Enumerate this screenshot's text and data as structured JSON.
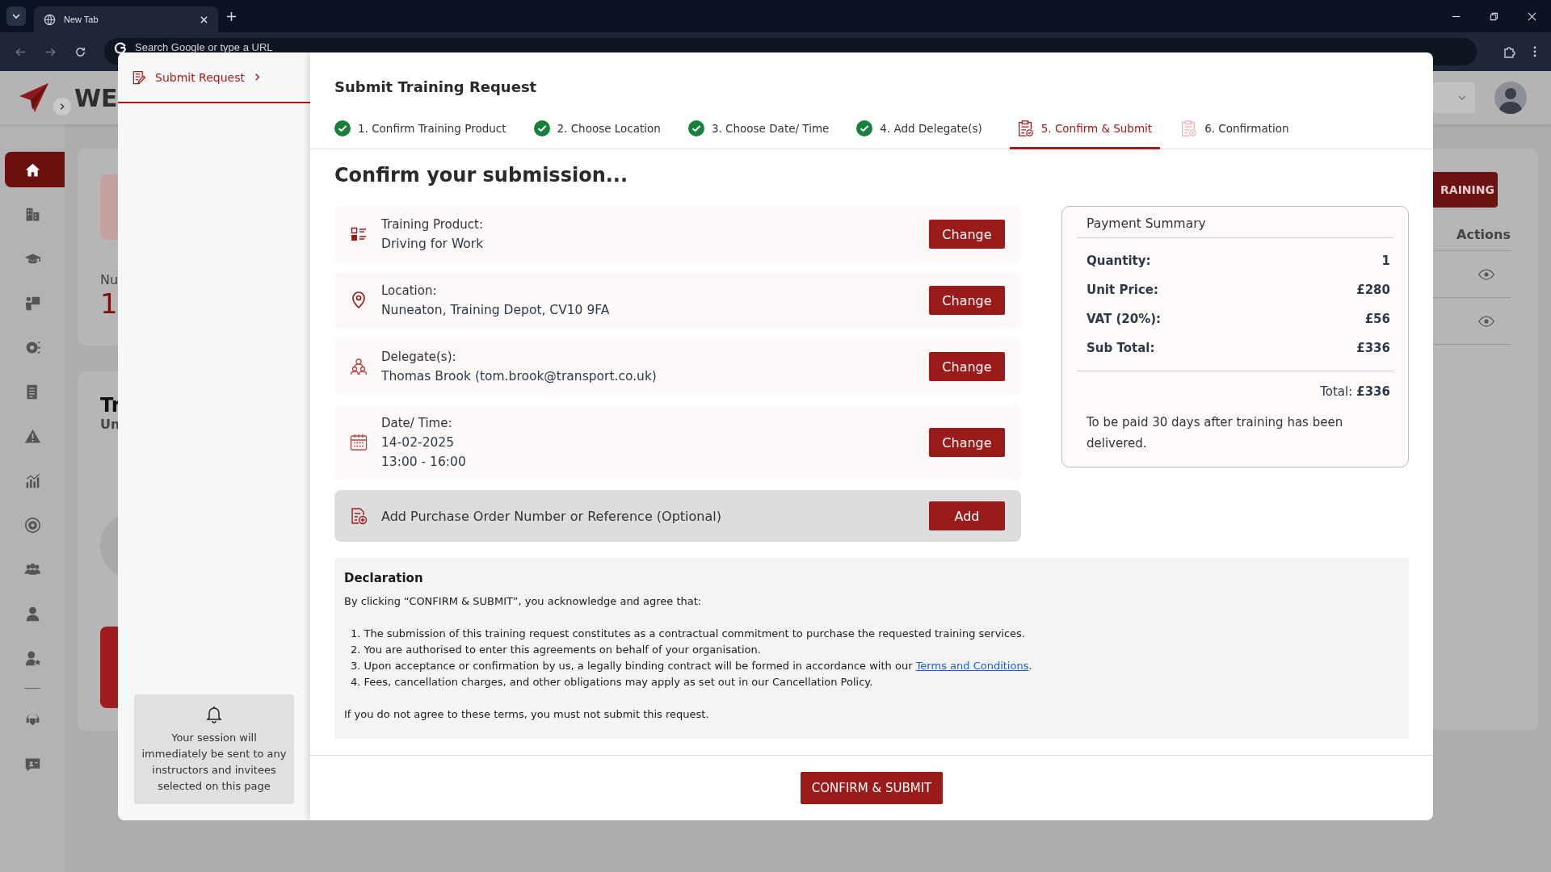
{
  "browser": {
    "tab_title": "New Tab",
    "address_placeholder": "Search Google or type a URL"
  },
  "app": {
    "logo_text": "WE",
    "nav": [
      {
        "selected": true
      },
      {
        "selected": false
      },
      {
        "selected": false
      },
      {
        "selected": false
      },
      {
        "selected": false
      },
      {
        "selected": false
      },
      {
        "selected": false
      },
      {
        "selected": false
      },
      {
        "selected": false
      },
      {
        "selected": false
      },
      {
        "selected": false
      },
      {
        "selected": false
      },
      {
        "selected": false
      },
      {
        "selected": false
      }
    ],
    "stat_label": "Nu",
    "stat_value": "1",
    "section_title": "Tr",
    "section_subtitle": "Un",
    "action_button": "RAINING",
    "table": {
      "columns": [
        "Actions"
      ]
    }
  },
  "modal": {
    "side_tab": {
      "label": "Submit Request",
      "selected": true
    },
    "notice": "Your session will immediately be sent to any instructors and invitees selected on this page",
    "title": "Submit Training Request",
    "steps": [
      {
        "label": "1. Confirm Training Product",
        "completed": true,
        "selected": false
      },
      {
        "label": "2. Choose Location",
        "completed": true,
        "selected": false
      },
      {
        "label": "3. Choose Date/ Time",
        "completed": true,
        "selected": false
      },
      {
        "label": "4. Add Delegate(s)",
        "completed": true,
        "selected": false
      },
      {
        "label": "5. Confirm & Submit",
        "completed": false,
        "selected": true
      },
      {
        "label": "6. Confirmation",
        "completed": false,
        "selected": false
      }
    ],
    "heading": "Confirm your submission...",
    "summary_items": [
      {
        "kind": "product",
        "label": "Training Product:",
        "values": [
          "Driving for Work"
        ],
        "button": "Change"
      },
      {
        "kind": "location",
        "label": "Location:",
        "values": [
          "Nuneaton, Training Depot, CV10 9FA"
        ],
        "button": "Change"
      },
      {
        "kind": "delegates",
        "label": "Delegate(s):",
        "values": [
          "Thomas Brook (tom.brook@transport.co.uk)"
        ],
        "button": "Change"
      },
      {
        "kind": "datetime",
        "label": "Date/ Time:",
        "values": [
          "14-02-2025",
          "13:00 - 16:00"
        ],
        "button": "Change"
      }
    ],
    "reference_row": {
      "label": "Add Purchase Order Number or Reference (Optional)",
      "button": "Add"
    },
    "payment_summary": {
      "title": "Payment Summary",
      "rows": [
        {
          "label": "Quantity:",
          "value": "1"
        },
        {
          "label": "Unit Price:",
          "value": "£280"
        },
        {
          "label": "VAT (20%):",
          "value": "£56"
        },
        {
          "label": "Sub Total:",
          "value": "£336"
        }
      ],
      "total_label": "Total:",
      "total_value": "£336",
      "note": "To be paid 30 days after training has been delivered."
    },
    "declaration": {
      "title": "Declaration",
      "intro": "By clicking “CONFIRM & SUBMIT”, you acknowledge and agree that:",
      "items": [
        {
          "text": "1. The submission of this training request constitutes as a contractual commitment to purchase the requested training services."
        },
        {
          "text": "2. You are authorised to enter this agreements on behalf of your organisation."
        },
        {
          "text": "3. Upon acceptance or confirmation by us, a legally binding contract will be formed in accordance with our ",
          "link": "Terms and Conditions",
          "after": "."
        },
        {
          "text": "4. Fees, cancellation charges, and other obligations may apply as set out in our Cancellation Policy."
        }
      ],
      "closing": "If you do not agree to these terms, you must not submit this request."
    },
    "submit_button": "CONFIRM & SUBMIT"
  }
}
